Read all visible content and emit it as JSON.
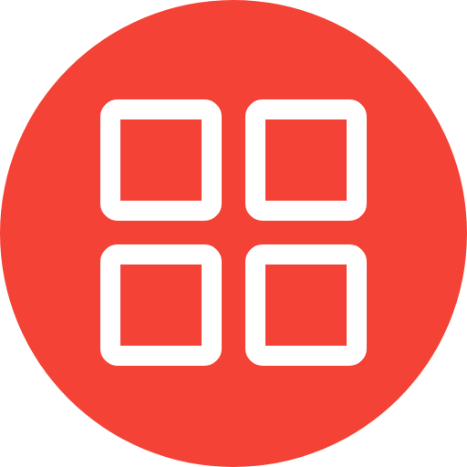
{
  "icon": {
    "name": "grid-icon",
    "background_shape": "circle",
    "background_color": "#F44336",
    "foreground_color": "#FFFFFF",
    "tiles": [
      {
        "name": "grid-tile-top-left"
      },
      {
        "name": "grid-tile-top-right"
      },
      {
        "name": "grid-tile-bottom-left"
      },
      {
        "name": "grid-tile-bottom-right"
      }
    ]
  }
}
